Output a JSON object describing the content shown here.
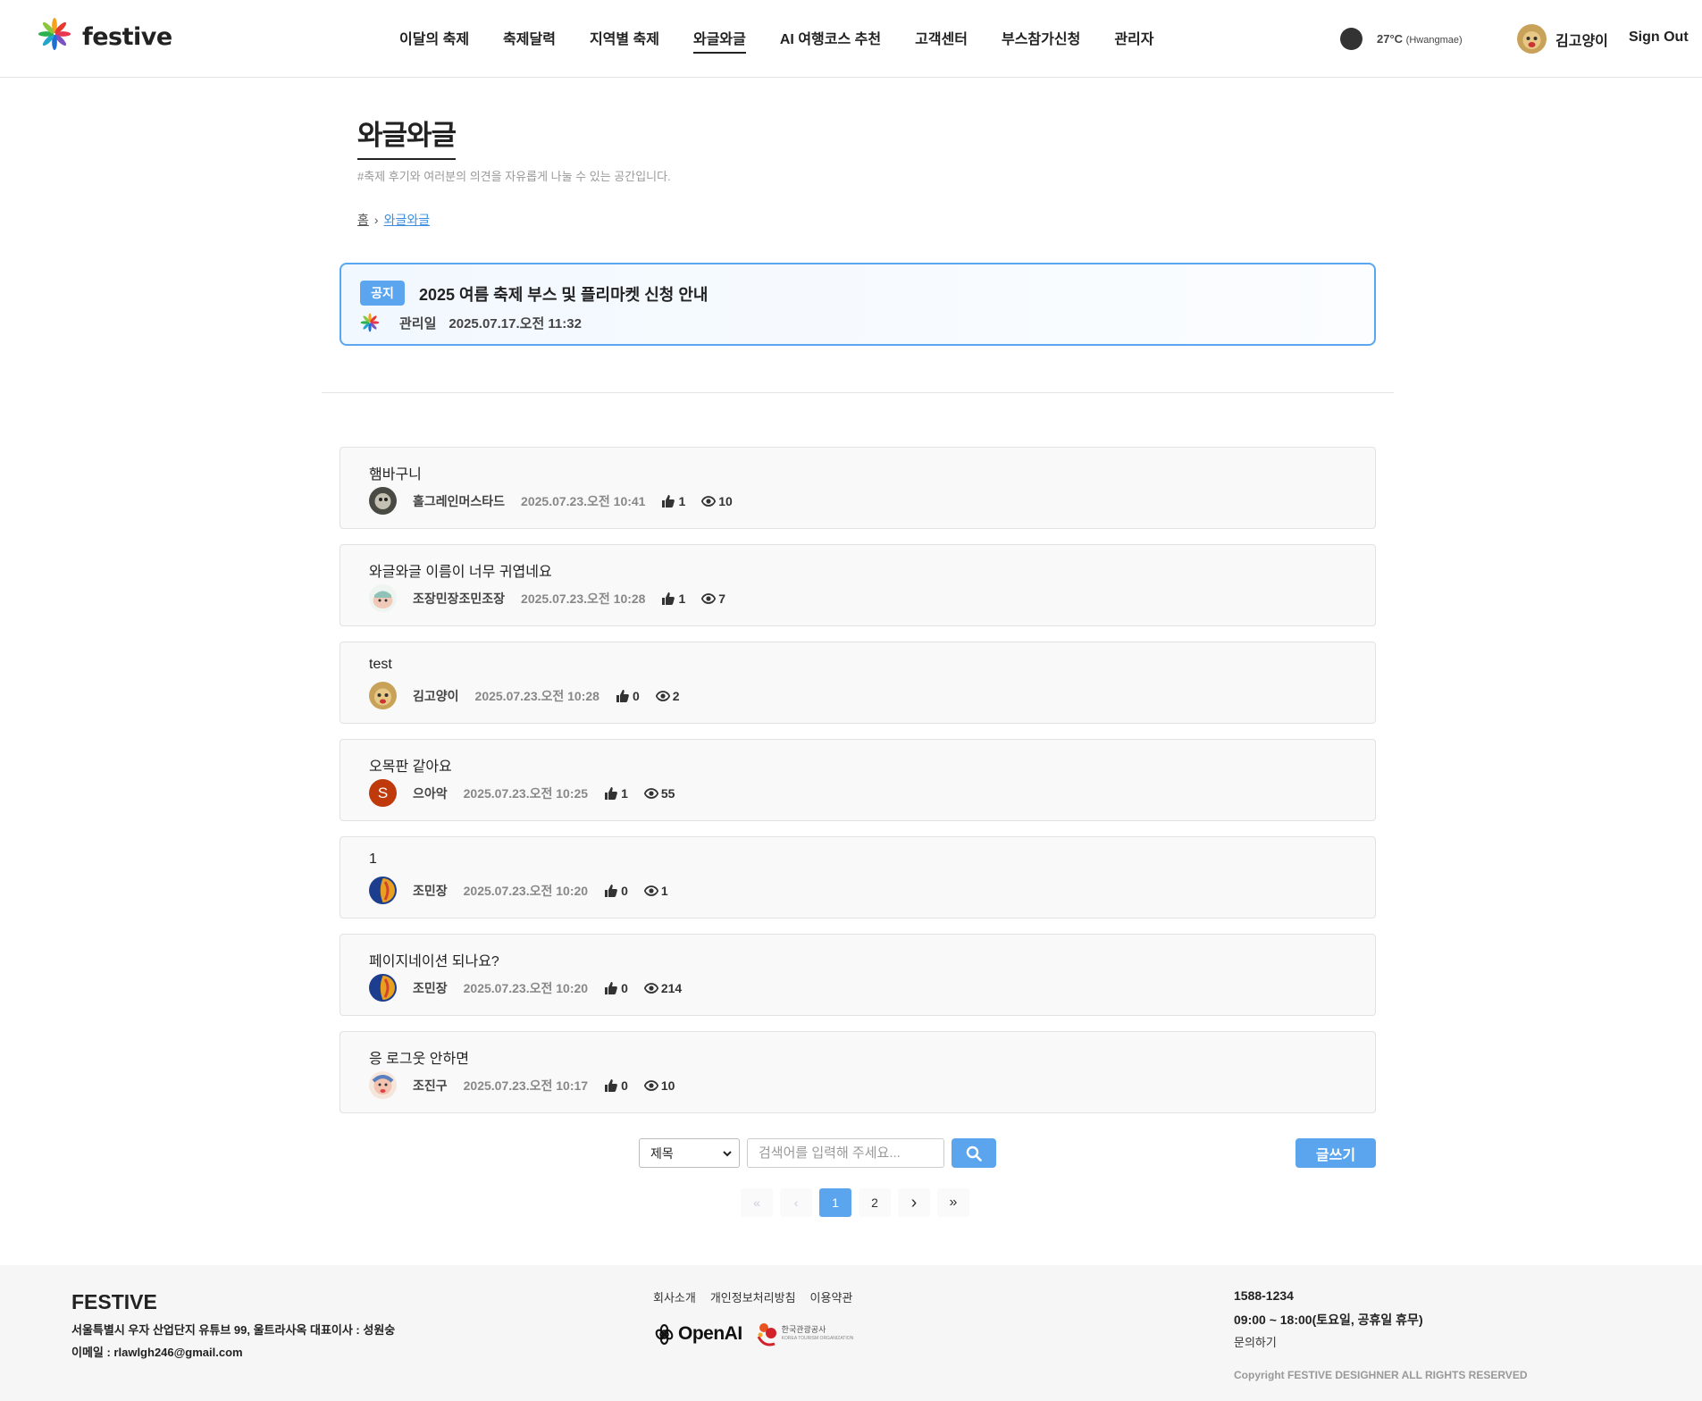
{
  "header": {
    "logo_text": "festive",
    "nav": [
      "이달의 축제",
      "축제달력",
      "지역별 축제",
      "와글와글",
      "AI 여행코스 추천",
      "고객센터",
      "부스참가신청",
      "관리자"
    ],
    "active_nav": "와글와글",
    "weather_temp": "27°C",
    "weather_location": "(Hwangmae)",
    "user_name": "김고양이",
    "signout": "Sign Out"
  },
  "page": {
    "title": "와글와글",
    "description": "#축제 후기와 여러분의 의견을 자유롭게 나눌 수 있는 공간입니다.",
    "breadcrumb_home": "홈",
    "breadcrumb_current": "와글와글"
  },
  "notice": {
    "badge": "공지",
    "title": "2025 여름 축제 부스 및 플리마켓 신청 안내",
    "author": "관리일",
    "date": "2025.07.17.오전 11:32"
  },
  "posts": [
    {
      "title": "햄바구니",
      "author": "홀그레인머스타드",
      "date": "2025.07.23.오전 10:41",
      "likes": "1",
      "views": "10"
    },
    {
      "title": "와글와글 이름이 너무 귀엽네요",
      "author": "조장민장조민조장",
      "date": "2025.07.23.오전 10:28",
      "likes": "1",
      "views": "7"
    },
    {
      "title": "test",
      "author": "김고양이",
      "date": "2025.07.23.오전 10:28",
      "likes": "0",
      "views": "2"
    },
    {
      "title": "오목판 같아요",
      "author": "으아악",
      "date": "2025.07.23.오전 10:25",
      "likes": "1",
      "views": "55",
      "avatar_letter": "S"
    },
    {
      "title": "1",
      "author": "조민장",
      "date": "2025.07.23.오전 10:20",
      "likes": "0",
      "views": "1"
    },
    {
      "title": "페이지네이션 되나요?",
      "author": "조민장",
      "date": "2025.07.23.오전 10:20",
      "likes": "0",
      "views": "214"
    },
    {
      "title": "응 로그웃 안하면",
      "author": "조진구",
      "date": "2025.07.23.오전 10:17",
      "likes": "0",
      "views": "10"
    }
  ],
  "search": {
    "select_value": "제목",
    "placeholder": "검색어를 입력해 주세요...",
    "write_label": "글쓰기"
  },
  "pagination": {
    "first": "«",
    "prev": "‹",
    "pages": [
      "1",
      "2"
    ],
    "current": "1",
    "next": "›",
    "last": "»"
  },
  "footer": {
    "brand": "FESTIVE",
    "address": "서울특별시 우자 산업단지 유튜브 99, 울트라사옥 대표이사 : 성원숭",
    "email": "이메일 : rlawlgh246@gmail.com",
    "links": [
      "회사소개",
      "개인정보처리방침",
      "이용약관"
    ],
    "openai": "OpenAI",
    "kto_name": "한국관광공사",
    "kto_en": "KOREA TOURISM ORGANIZATION",
    "phone": "1588-1234",
    "hours": "09:00 ~ 18:00(토요일, 공휴일 휴무)",
    "inquiry": "문의하기",
    "copyright": "Copyright FESTIVE DESIGHNER ALL RIGHTS RESERVED"
  },
  "colors": {
    "accent": "#5ba5ef",
    "notice_border": "#5aa6f0"
  }
}
